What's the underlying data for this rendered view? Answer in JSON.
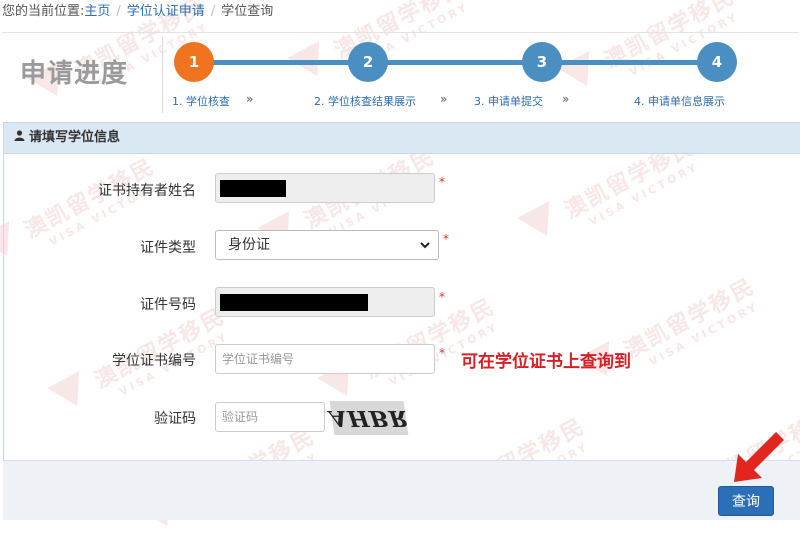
{
  "breadcrumb": {
    "prefix": "您的当前位置:",
    "home": "主页",
    "section": "学位认证申请",
    "current": "学位查询",
    "separator": "/"
  },
  "progress": {
    "title": "申请进度",
    "steps": [
      {
        "number": "1",
        "label": "1. 学位核查",
        "active": true
      },
      {
        "number": "2",
        "label": "2. 学位核查结果展示",
        "active": false
      },
      {
        "number": "3",
        "label": "3. 申请单提交",
        "active": false
      },
      {
        "number": "4",
        "label": "4. 申请单信息展示",
        "active": false
      }
    ],
    "arrow": "»"
  },
  "form": {
    "panel_title": "请填写学位信息",
    "holder_name_label": "证书持有者姓名",
    "id_type_label": "证件类型",
    "id_type_value": "身份证",
    "id_number_label": "证件号码",
    "cert_number_label": "学位证书编号",
    "cert_number_placeholder": "学位证书编号",
    "captcha_label": "验证码",
    "captcha_placeholder": "验证码",
    "captcha_text": "AHBR",
    "required_mark": "*",
    "hint": "可在学位证书上查询到"
  },
  "actions": {
    "query_label": "查询"
  },
  "watermark": {
    "cn": "澳凯留学移民",
    "en": "VISA VICTORY"
  },
  "colors": {
    "accent": "#4a8ec2",
    "active_step": "#f0731f",
    "hint": "#d61f26",
    "button": "#2b6fb8",
    "arrow": "#e0261e"
  }
}
